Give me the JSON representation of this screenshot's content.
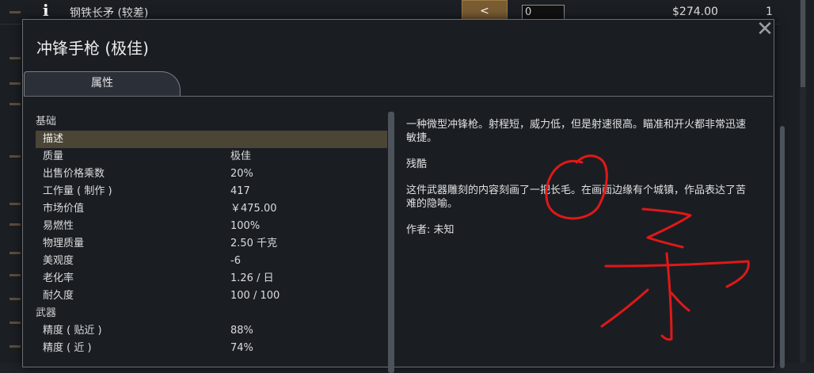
{
  "background_list": {
    "row": {
      "info_symbol": "i",
      "item_name": "钢铁长矛 (较差)",
      "transfer_arrow": "<",
      "quantity_value": "0",
      "price": "$274.00",
      "count": "1"
    }
  },
  "dialog": {
    "title": "冲锋手枪 (极佳)",
    "close_symbol": "✕",
    "tab_label": "属性",
    "stats": {
      "category_basic": "基础",
      "rows_basic": [
        {
          "label": "描述",
          "value": ""
        },
        {
          "label": "质量",
          "value": "极佳"
        },
        {
          "label": "出售价格乘数",
          "value": "20%"
        },
        {
          "label": "工作量 ( 制作 )",
          "value": "417"
        },
        {
          "label": "市场价值",
          "value": "￥475.00"
        },
        {
          "label": "易燃性",
          "value": "100%"
        },
        {
          "label": "物理质量",
          "value": "2.50 千克"
        },
        {
          "label": "美观度",
          "value": "-6"
        },
        {
          "label": "老化率",
          "value": "1.26 / 日"
        },
        {
          "label": "耐久度",
          "value": "100 / 100"
        }
      ],
      "category_weapon": "武器",
      "rows_weapon": [
        {
          "label": "精度 ( 贴近 )",
          "value": "88%"
        },
        {
          "label": "精度 ( 近 )",
          "value": "74%"
        }
      ]
    },
    "description": {
      "line1": "一种微型冲锋枪。射程短，威力低，但是射速很高。瞄准和开火都非常迅速敏捷。",
      "line2": "残酷",
      "line3": "这件武器雕刻的内容刻画了一把长毛。在画面边缘有个城镇，作品表达了苦难的隐喻。",
      "line4": "作者: 未知"
    }
  },
  "colors": {
    "background": "#1b1f24",
    "dialog": "#1a1e23",
    "selected_row": "#4a4535",
    "arrow_button": "#7a5c33",
    "annotation_red": "#e01818"
  }
}
